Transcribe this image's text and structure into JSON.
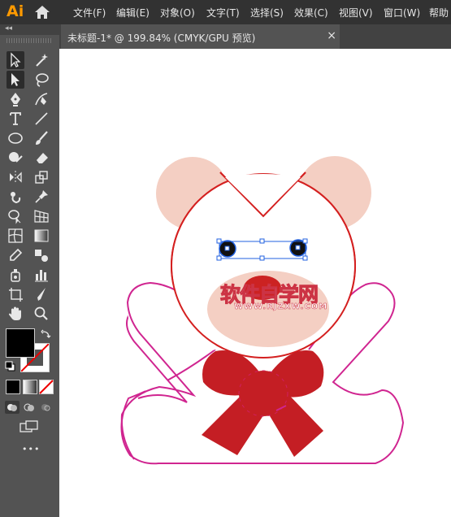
{
  "app": {
    "logo": "Ai"
  },
  "menu": [
    "文件(F)",
    "编辑(E)",
    "对象(O)",
    "文字(T)",
    "选择(S)",
    "效果(C)",
    "视图(V)",
    "窗口(W)",
    "帮助"
  ],
  "document_tab": {
    "title": "未标题-1* @ 199.84% (CMYK/GPU 预览)",
    "close": "×"
  },
  "toolbar": {
    "collapse": "◂◂",
    "more": "•••",
    "tools_left": [
      "selection-tool",
      "direct-selection-tool",
      "pen-tool",
      "type-tool",
      "ellipse-tool",
      "shaper-tool",
      "reflect-tool",
      "puppet-warp-tool",
      "shape-builder-tool",
      "mesh-tool",
      "eyedropper-tool",
      "symbol-sprayer-tool",
      "artboard-tool",
      "hand-tool"
    ],
    "tools_right": [
      "magic-wand-tool",
      "lasso-tool",
      "curvature-tool",
      "line-segment-tool",
      "paintbrush-tool",
      "eraser-tool",
      "scale-tool",
      "pin-tool",
      "perspective-grid-tool",
      "gradient-tool",
      "blend-tool",
      "column-graph-tool",
      "slice-tool",
      "zoom-tool"
    ]
  },
  "colors": {
    "fill": "#000000",
    "stroke": "#ffffff",
    "ears": "#f4cfc3",
    "head_stroke": "#d42020",
    "body_stroke": "#d02590",
    "nose": "#cc2222",
    "bow": "#c41e24",
    "selection": "#2060e0",
    "watermark_fill": "#ffffff",
    "watermark_stroke": "#cc3344"
  },
  "watermark": {
    "line1": "软件自学网",
    "line2": "WWW.RJZXW.COM"
  }
}
